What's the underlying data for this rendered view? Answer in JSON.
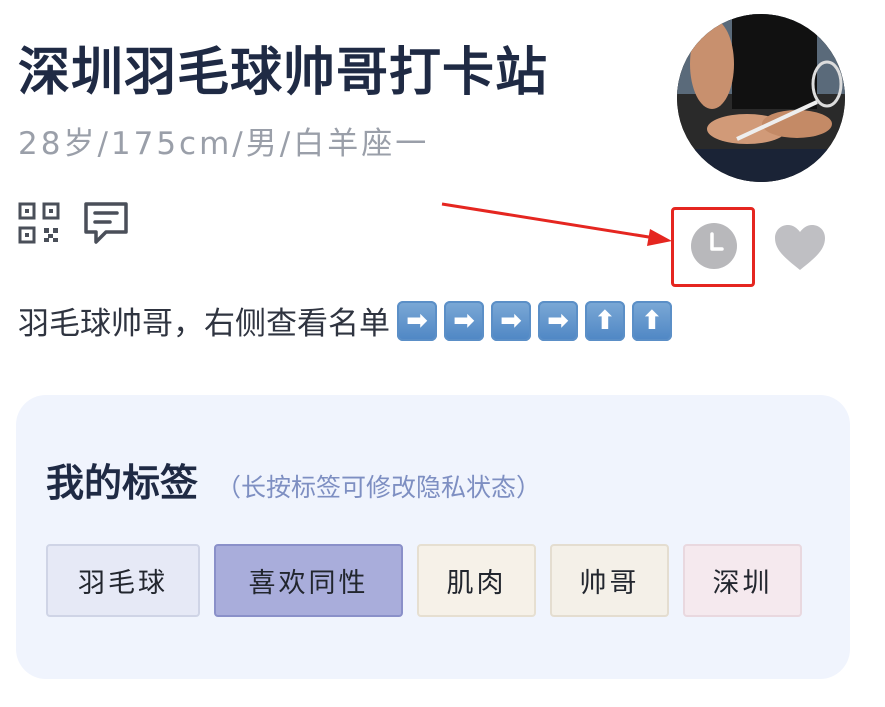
{
  "profile": {
    "title": "深圳羽毛球帅哥打卡站",
    "subtitle": "28岁/175cm/男/白羊座一",
    "bio": "羽毛球帅哥，右侧查看名单",
    "bio_emojis": [
      "➡",
      "➡",
      "➡",
      "➡",
      "⬆",
      "⬆"
    ]
  },
  "icons": {
    "qr": "qr-code-icon",
    "message": "message-icon",
    "clock": "clock-icon",
    "heart": "heart-icon"
  },
  "colors": {
    "highlight_box": "#e52620",
    "card_bg": "#f0f4fd",
    "title": "#1f2a44"
  },
  "tags_section": {
    "title": "我的标签",
    "hint": "（长按标签可修改隐私状态）",
    "tags": [
      {
        "label": "羽毛球",
        "bg": "#e6e9f6",
        "border": "#cfd4e6"
      },
      {
        "label": "喜欢同性",
        "bg": "#a9addb",
        "border": "#8a90c9"
      },
      {
        "label": "肌肉",
        "bg": "#f6f1e8",
        "border": "#e6dfd1"
      },
      {
        "label": "帅哥",
        "bg": "#f4f0e8",
        "border": "#e4ddd0"
      },
      {
        "label": "深圳",
        "bg": "#f5e9ee",
        "border": "#e9d8df"
      }
    ]
  }
}
